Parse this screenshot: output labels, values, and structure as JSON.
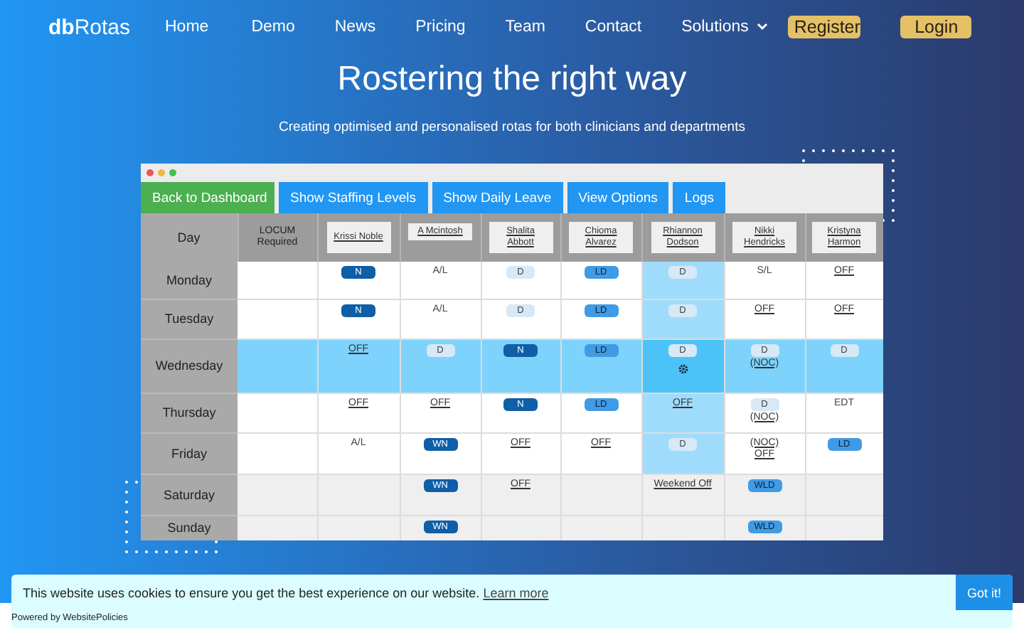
{
  "logo": "**db**Rotas",
  "nav": [
    {
      "label": "Home",
      "kind": "link"
    },
    {
      "label": "Demo",
      "kind": "link"
    },
    {
      "label": "News",
      "kind": "link"
    },
    {
      "label": "Pricing",
      "kind": "link"
    },
    {
      "label": "Team",
      "kind": "link"
    },
    {
      "label": "Contact",
      "kind": "link"
    },
    {
      "label": "Solutions",
      "kind": "dropdown"
    },
    {
      "label": "Register",
      "kind": "button"
    },
    {
      "label": "Login",
      "kind": "button"
    }
  ],
  "hero": {
    "title": "Rostering the right way",
    "subtitle": "Creating optimised and personalised rotas for both clinicians and departments"
  },
  "app": {
    "tabs": [
      {
        "label": "Back to Dashboard",
        "color": "#4caf50"
      },
      {
        "label": "Show Staffing Levels",
        "color": "#2196f3"
      },
      {
        "label": "Show Daily Leave",
        "color": "#2196f3"
      },
      {
        "label": "View Options",
        "color": "#2196f3"
      },
      {
        "label": "Logs",
        "color": "#2196f3"
      }
    ],
    "table": {
      "day_heading": "Day",
      "locum_heading": "LOCUM Required",
      "staff": [
        {
          "name": "Krissi Noble",
          "highlighted": false
        },
        {
          "name": "A Mcintosh",
          "highlighted": false
        },
        {
          "name": "Shalita Abbott",
          "highlighted": false
        },
        {
          "name": "Chioma Alvarez",
          "highlighted": false
        },
        {
          "name": "Rhiannon Dodson",
          "highlighted": true
        },
        {
          "name": "Nikki Hendricks",
          "highlighted": false
        },
        {
          "name": "Kristyna Harmon",
          "highlighted": false
        }
      ],
      "rows": [
        {
          "day": "Monday",
          "kind": "normal",
          "cells": [
            [
              {
                "text": "N",
                "kind": "night"
              }
            ],
            [
              {
                "text": "A/L",
                "kind": "plain"
              }
            ],
            [
              {
                "text": "D",
                "kind": "day"
              }
            ],
            [
              {
                "text": "LD",
                "kind": "long"
              }
            ],
            [
              {
                "text": "D",
                "kind": "day"
              }
            ],
            [
              {
                "text": "S/L",
                "kind": "plain"
              }
            ],
            [
              {
                "text": "OFF",
                "kind": "link"
              }
            ]
          ]
        },
        {
          "day": "Tuesday",
          "kind": "normal",
          "cells": [
            [
              {
                "text": "N",
                "kind": "night"
              }
            ],
            [
              {
                "text": "A/L",
                "kind": "plain"
              }
            ],
            [
              {
                "text": "D",
                "kind": "day"
              }
            ],
            [
              {
                "text": "LD",
                "kind": "long"
              }
            ],
            [
              {
                "text": "D",
                "kind": "day"
              }
            ],
            [
              {
                "text": "OFF",
                "kind": "link"
              }
            ],
            [
              {
                "text": "OFF",
                "kind": "link"
              }
            ]
          ]
        },
        {
          "day": "Wednesday",
          "kind": "highlighted",
          "cells": [
            [
              {
                "text": "OFF",
                "kind": "link"
              }
            ],
            [
              {
                "text": "D",
                "kind": "day"
              }
            ],
            [
              {
                "text": "N",
                "kind": "night"
              }
            ],
            [
              {
                "text": "LD",
                "kind": "long"
              }
            ],
            [
              {
                "text": "D",
                "kind": "day"
              },
              {
                "kind": "gear"
              }
            ],
            [
              {
                "text": "D",
                "kind": "day"
              },
              {
                "text": "(NOC)",
                "kind": "link"
              }
            ],
            [
              {
                "text": "D",
                "kind": "day"
              }
            ]
          ]
        },
        {
          "day": "Thursday",
          "kind": "normal",
          "cells": [
            [
              {
                "text": "OFF",
                "kind": "link"
              }
            ],
            [
              {
                "text": "OFF",
                "kind": "link"
              }
            ],
            [
              {
                "text": "N",
                "kind": "night"
              }
            ],
            [
              {
                "text": "LD",
                "kind": "long"
              }
            ],
            [
              {
                "text": "OFF",
                "kind": "link"
              }
            ],
            [
              {
                "text": "D",
                "kind": "day"
              },
              {
                "text": "(NOC)",
                "kind": "link"
              }
            ],
            [
              {
                "text": "EDT",
                "kind": "plain"
              }
            ]
          ]
        },
        {
          "day": "Friday",
          "kind": "normal",
          "cells": [
            [
              {
                "text": "A/L",
                "kind": "plain"
              }
            ],
            [
              {
                "text": "WN",
                "kind": "night"
              }
            ],
            [
              {
                "text": "OFF",
                "kind": "link"
              }
            ],
            [
              {
                "text": "OFF",
                "kind": "link"
              }
            ],
            [
              {
                "text": "D",
                "kind": "day"
              }
            ],
            [
              {
                "text": "(NOC)",
                "kind": "link"
              },
              {
                "text": "OFF",
                "kind": "link"
              }
            ],
            [
              {
                "text": "LD",
                "kind": "long"
              }
            ]
          ]
        },
        {
          "day": "Saturday",
          "kind": "weekend",
          "cells": [
            [],
            [
              {
                "text": "WN",
                "kind": "night"
              }
            ],
            [
              {
                "text": "OFF",
                "kind": "link"
              }
            ],
            [],
            [
              {
                "text": "Weekend Off",
                "kind": "link"
              }
            ],
            [
              {
                "text": "WLD",
                "kind": "long"
              }
            ],
            []
          ]
        },
        {
          "day": "Sunday",
          "kind": "weekend",
          "cells": [
            [],
            [
              {
                "text": "WN",
                "kind": "night"
              }
            ],
            [],
            [],
            [],
            [
              {
                "text": "WLD",
                "kind": "long"
              }
            ],
            []
          ]
        }
      ]
    }
  },
  "cookie": {
    "message": "This website uses cookies to ensure you get the best experience on our website.",
    "link": "Learn more",
    "button": "Got it!",
    "powered": "Powered by WebsitePolicies"
  }
}
